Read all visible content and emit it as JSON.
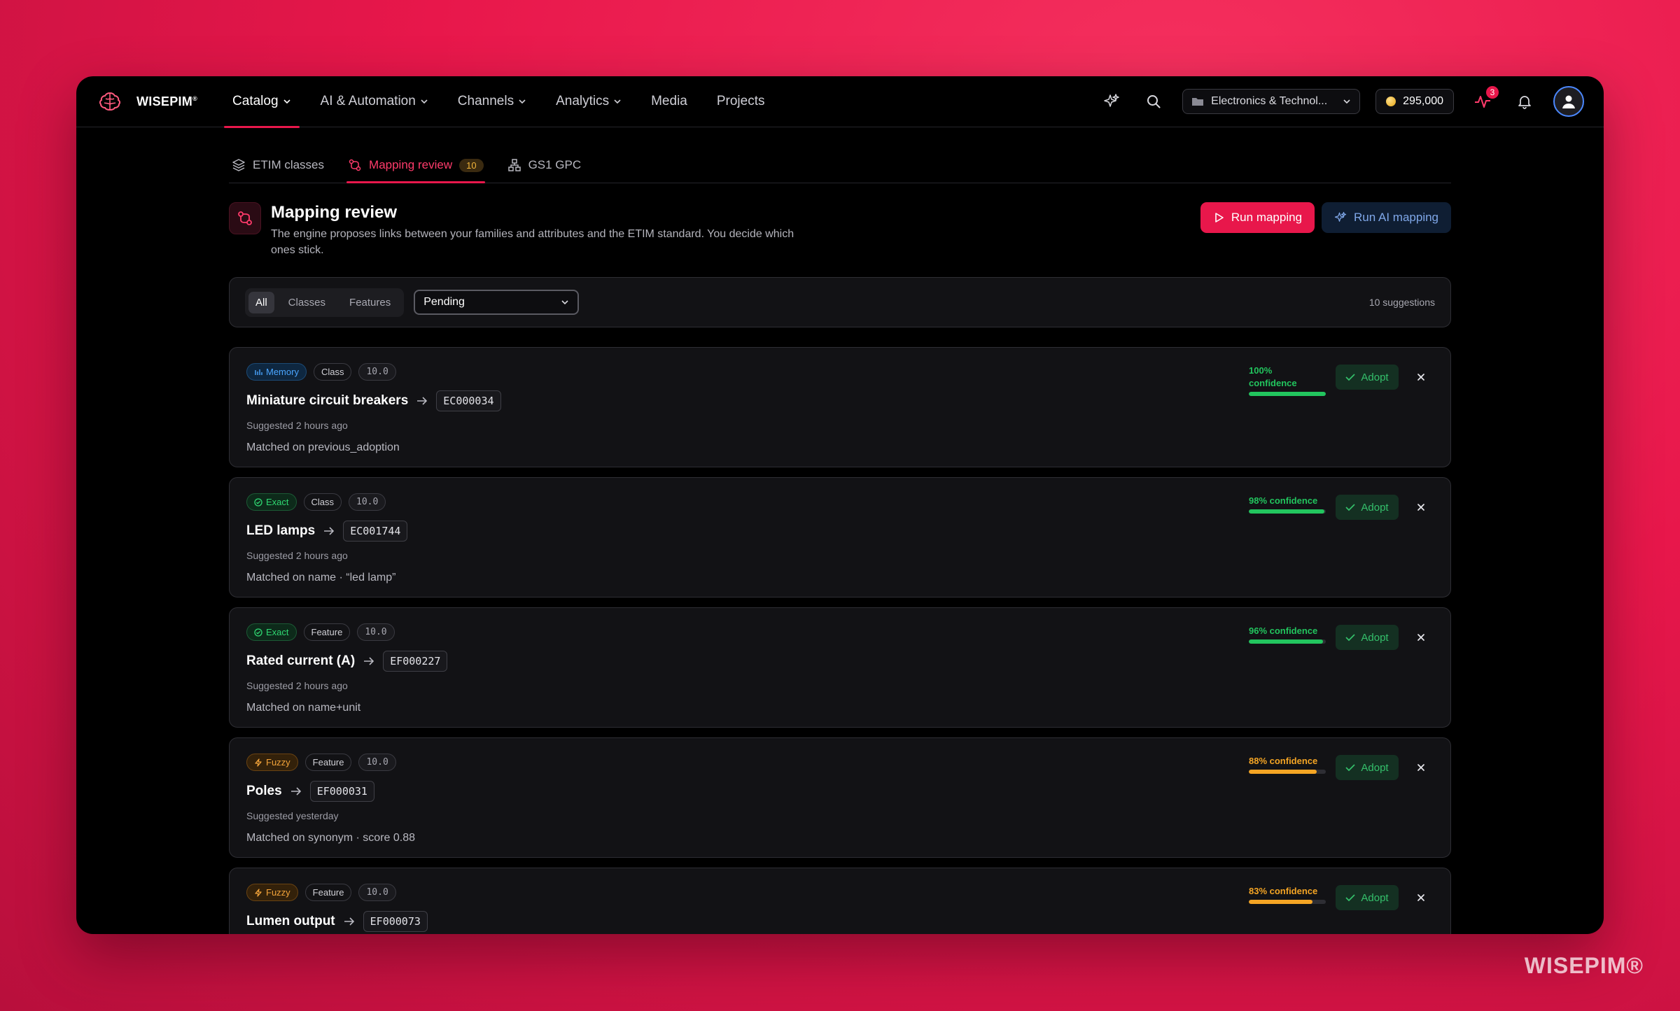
{
  "brand": {
    "name": "WISEPIM",
    "mark": "®"
  },
  "nav": {
    "items": [
      {
        "label": "Catalog",
        "dropdown": true,
        "active": true
      },
      {
        "label": "AI & Automation",
        "dropdown": true
      },
      {
        "label": "Channels",
        "dropdown": true
      },
      {
        "label": "Analytics",
        "dropdown": true
      },
      {
        "label": "Media"
      },
      {
        "label": "Projects"
      }
    ],
    "workspace": "Electronics & Technol...",
    "credits": "295,000",
    "activity_badge": "3"
  },
  "subtabs": [
    {
      "label": "ETIM classes"
    },
    {
      "label": "Mapping review",
      "count": "10",
      "active": true
    },
    {
      "label": "GS1 GPC"
    }
  ],
  "page": {
    "title": "Mapping review",
    "description": "The engine proposes links between your families and attributes and the ETIM standard. You decide which ones stick.",
    "run_mapping": "Run mapping",
    "run_ai_mapping": "Run AI mapping"
  },
  "filters": {
    "segments": [
      "All",
      "Classes",
      "Features"
    ],
    "active_segment": "All",
    "status_value": "Pending",
    "count_text": "10 suggestions"
  },
  "suggestions": [
    {
      "kind": "Memory",
      "type": "Class",
      "version": "10.0",
      "name": "Miniature circuit breakers",
      "code": "EC000034",
      "suggested": "Suggested 2 hours ago",
      "match": "Matched on previous_adoption",
      "confidence": 100,
      "confidence_text": "100% confidence",
      "color": "#22c55e"
    },
    {
      "kind": "Exact",
      "type": "Class",
      "version": "10.0",
      "name": "LED lamps",
      "code": "EC001744",
      "suggested": "Suggested 2 hours ago",
      "match": "Matched on name · “led lamp”",
      "confidence": 98,
      "confidence_text": "98% confidence",
      "color": "#22c55e"
    },
    {
      "kind": "Exact",
      "type": "Feature",
      "version": "10.0",
      "name": "Rated current (A)",
      "code": "EF000227",
      "suggested": "Suggested 2 hours ago",
      "match": "Matched on name+unit",
      "confidence": 96,
      "confidence_text": "96% confidence",
      "color": "#22c55e"
    },
    {
      "kind": "Fuzzy",
      "type": "Feature",
      "version": "10.0",
      "name": "Poles",
      "code": "EF000031",
      "suggested": "Suggested yesterday",
      "match": "Matched on synonym · score 0.88",
      "confidence": 88,
      "confidence_text": "88% confidence",
      "color": "#f5a524"
    },
    {
      "kind": "Fuzzy",
      "type": "Feature",
      "version": "10.0",
      "name": "Lumen output",
      "code": "EF000073",
      "suggested": "",
      "match": "",
      "confidence": 83,
      "confidence_text": "83% confidence",
      "color": "#f5a524"
    }
  ],
  "adopt_label": "Adopt",
  "watermark": "WISEPIM®"
}
